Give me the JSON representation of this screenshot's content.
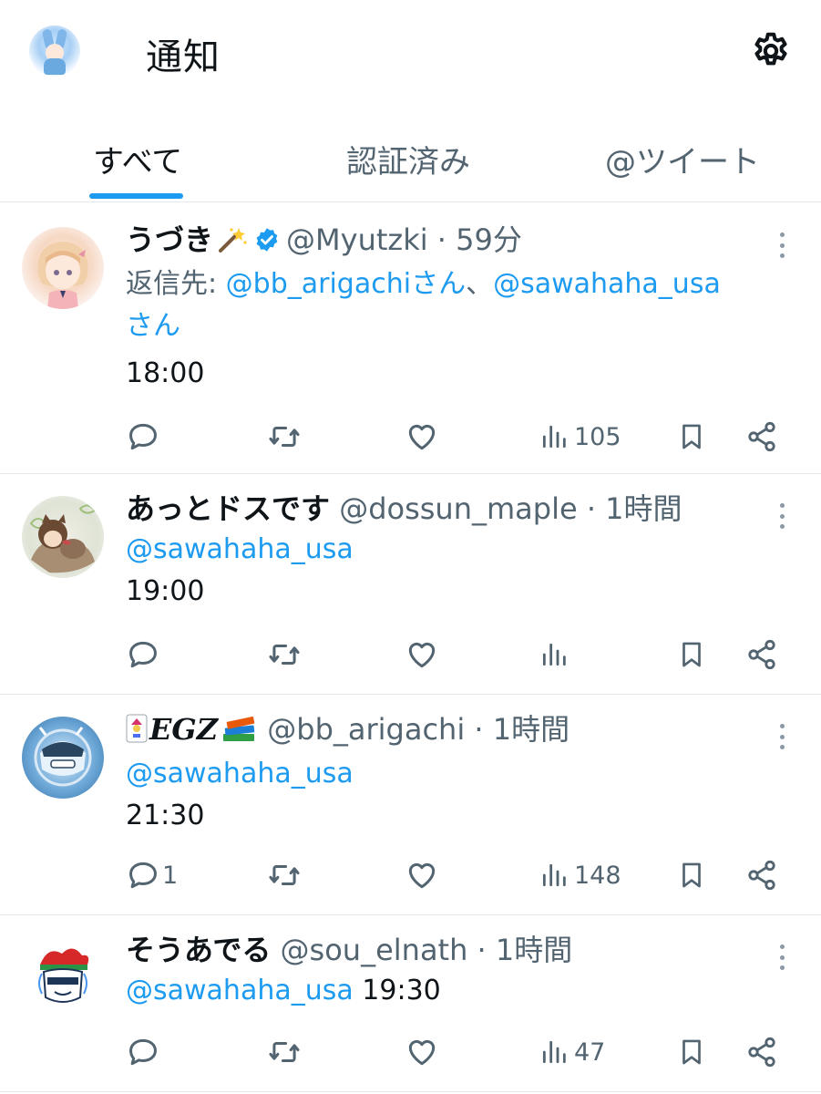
{
  "header": {
    "title": "通知"
  },
  "tabs": [
    {
      "label": "すべて",
      "active": true
    },
    {
      "label": "認証済み",
      "active": false
    },
    {
      "label": "@ツイート",
      "active": false
    }
  ],
  "tweets": [
    {
      "name": "うづき",
      "name_emoji": "magic-wand-emoji",
      "verified": true,
      "handle": "@Myutzki",
      "separator": "·",
      "time": "59分",
      "reply_prefix": "返信先: ",
      "reply_mention_1": "@bb_arigachiさん",
      "reply_comma": "、",
      "reply_mention_2": "@sawahaha_usa",
      "reply_suffix": "さん",
      "text": "18:00",
      "views": "105",
      "replies": ""
    },
    {
      "name": "あっとドスです",
      "handle": "@dossun_maple",
      "separator": "·",
      "time": "1時間",
      "mention": "@sawahaha_usa",
      "text": "19:00",
      "views": "",
      "replies": ""
    },
    {
      "name": "𝑬𝑮𝒁",
      "name_emoji_prefix": "joker-card-emoji",
      "name_emoji_suffix": "books-emoji",
      "handle": "@bb_arigachi",
      "separator": "·",
      "time": "1時間",
      "mention": "@sawahaha_usa",
      "text": "21:30",
      "views": "148",
      "replies": "1"
    },
    {
      "name": "そうあでる",
      "handle": "@sou_elnath",
      "separator": "·",
      "time": "1時間",
      "mention": "@sawahaha_usa",
      "text": " 19:30",
      "views": "47",
      "replies": ""
    }
  ],
  "colors": {
    "accent": "#1d9bf0",
    "verified": "#1d9bf0",
    "text": "#0f1419",
    "muted": "#536471"
  }
}
